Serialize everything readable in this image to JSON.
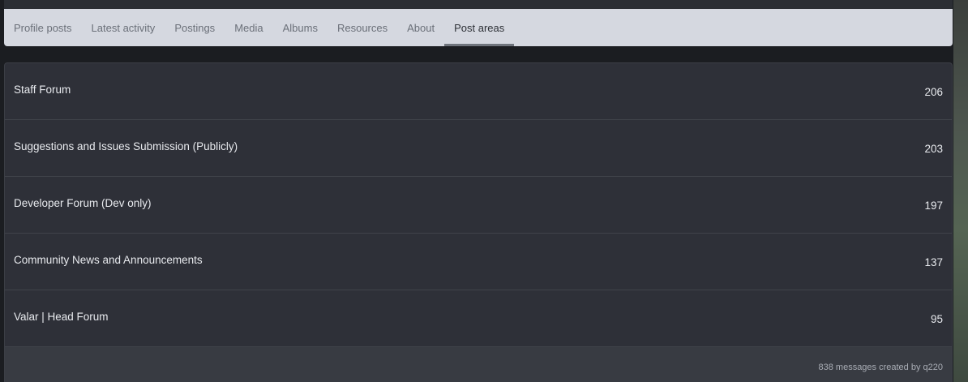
{
  "tabs": [
    {
      "label": "Profile posts",
      "active": false
    },
    {
      "label": "Latest activity",
      "active": false
    },
    {
      "label": "Postings",
      "active": false
    },
    {
      "label": "Media",
      "active": false
    },
    {
      "label": "Albums",
      "active": false
    },
    {
      "label": "Resources",
      "active": false
    },
    {
      "label": "About",
      "active": false
    },
    {
      "label": "Post areas",
      "active": true
    }
  ],
  "forums": [
    {
      "title": "Staff Forum",
      "count": "206"
    },
    {
      "title": "Suggestions and Issues Submission (Publicly)",
      "count": "203"
    },
    {
      "title": "Developer Forum (Dev only)",
      "count": "197"
    },
    {
      "title": "Community News and Announcements",
      "count": "137"
    },
    {
      "title": "Valar | Head Forum",
      "count": "95"
    }
  ],
  "footer": {
    "summary": "838 messages created by q220"
  }
}
